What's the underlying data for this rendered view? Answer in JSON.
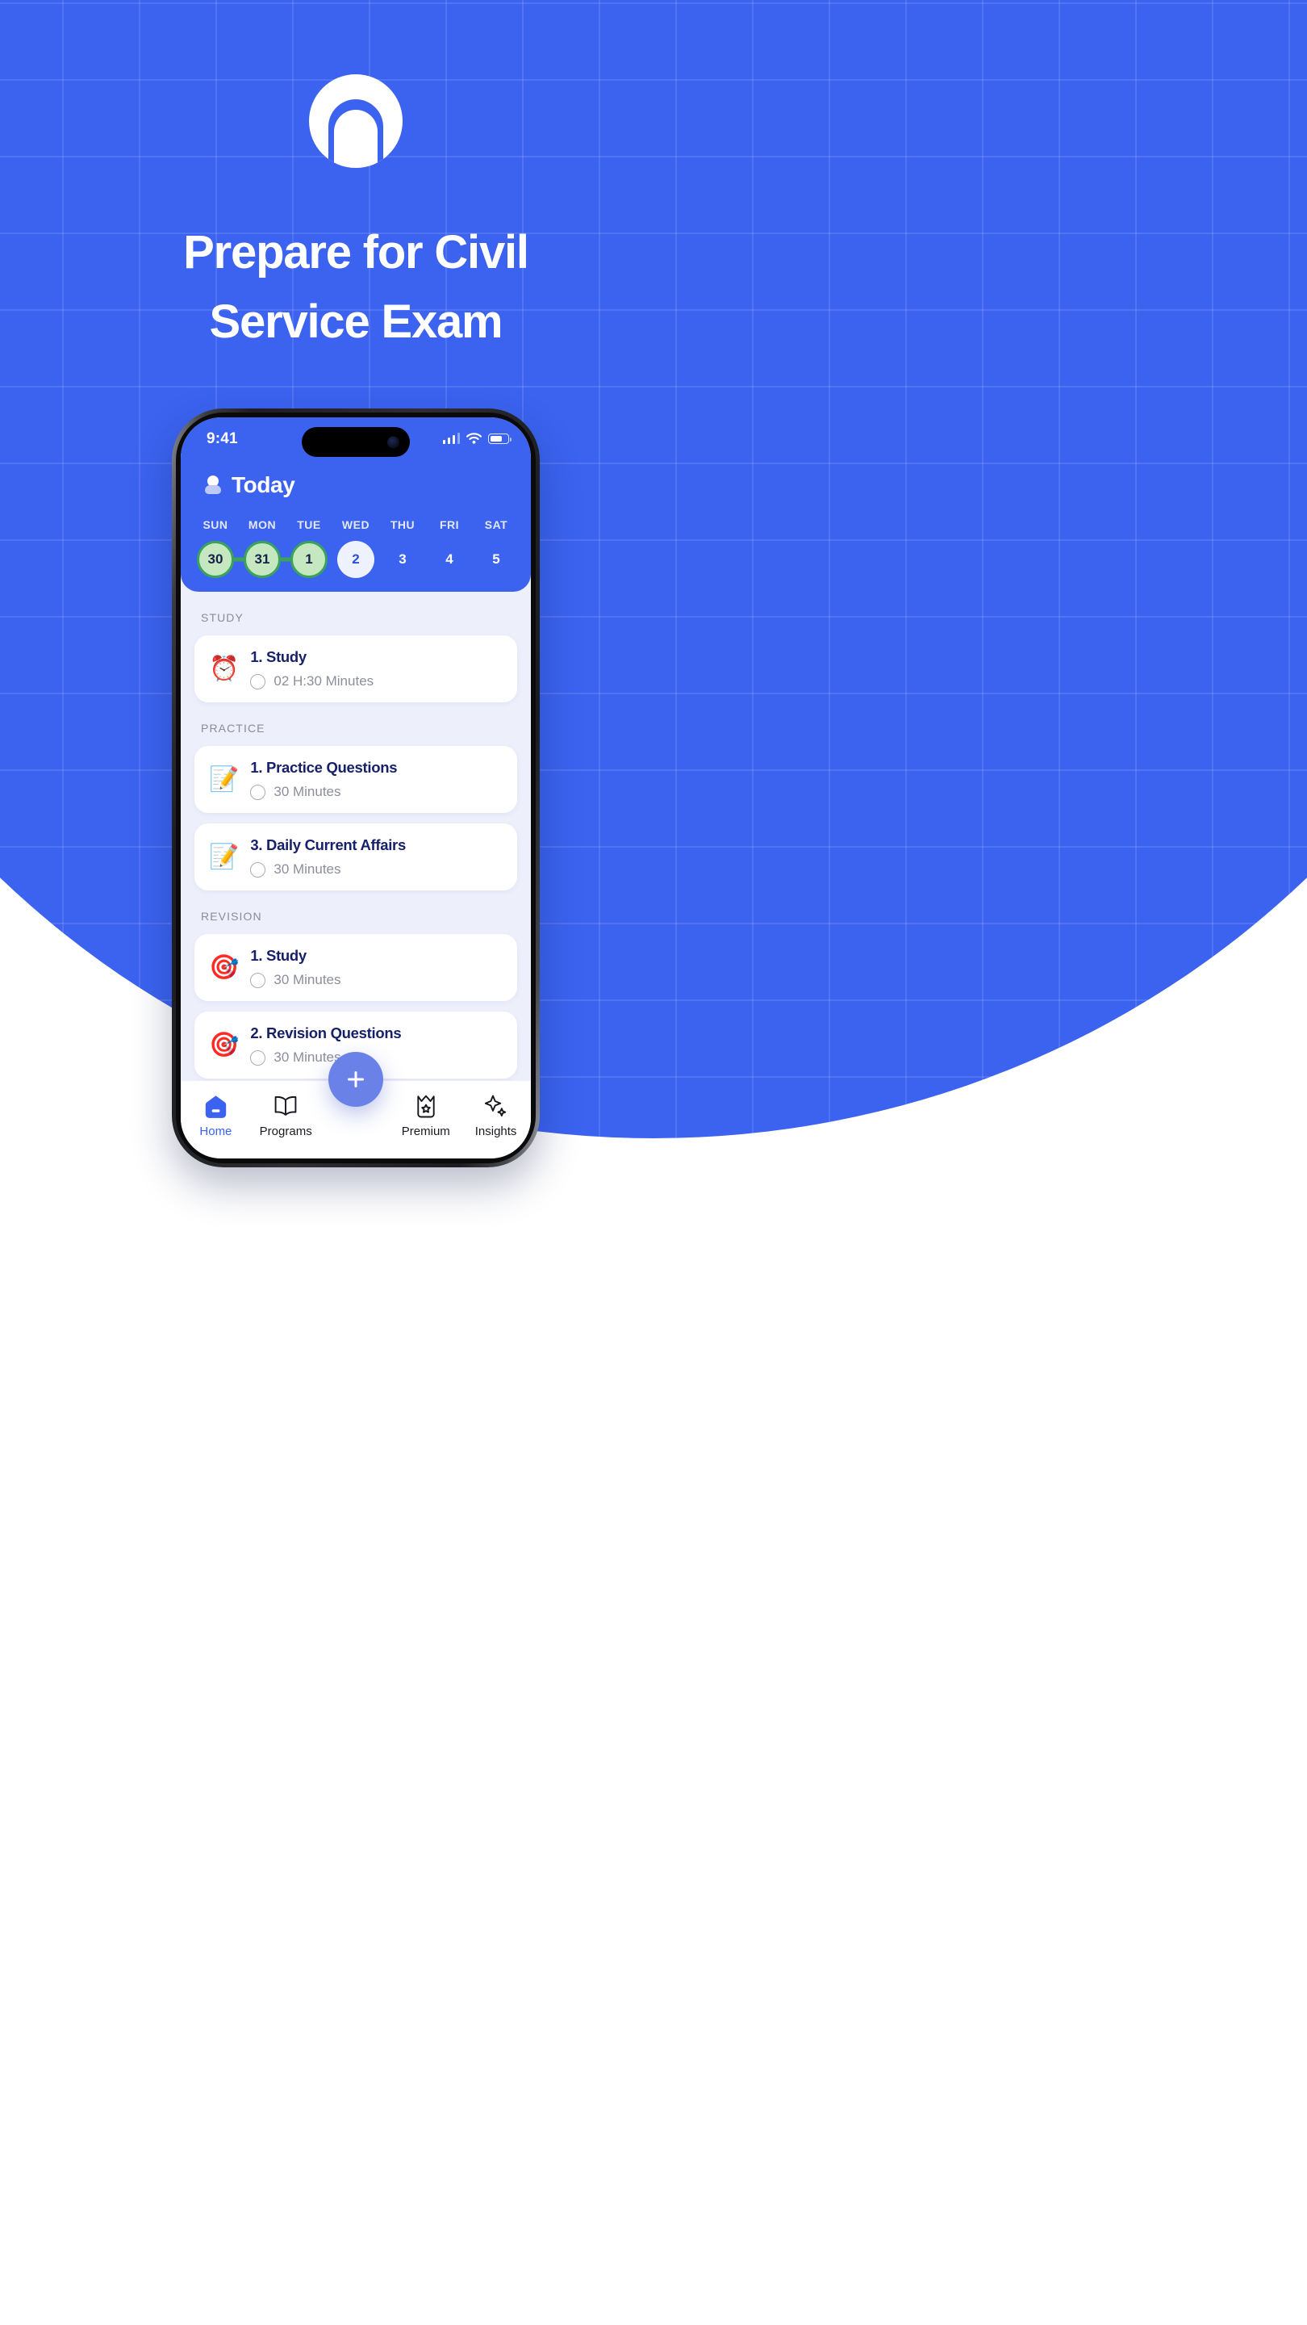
{
  "promo": {
    "logo_icon": "arch-circle-logo",
    "headline_line1": "Prepare for Civil",
    "headline_line2": "Service Exam",
    "bg_color": "#3B63F0",
    "accent_color": "#6A81E8"
  },
  "phone": {
    "status_bar": {
      "time": "9:41",
      "signal_icon": "cellular-signal-icon",
      "wifi_icon": "wifi-icon",
      "battery_icon": "battery-icon",
      "battery_level": "70%"
    },
    "header": {
      "avatar_icon": "person-avatar-icon",
      "title": "Today"
    },
    "calendar": {
      "weekdays": [
        "SUN",
        "MON",
        "TUE",
        "WED",
        "THU",
        "FRI",
        "SAT"
      ],
      "days": [
        {
          "num": "30",
          "state": "done"
        },
        {
          "num": "31",
          "state": "done"
        },
        {
          "num": "1",
          "state": "done"
        },
        {
          "num": "2",
          "state": "today"
        },
        {
          "num": "3",
          "state": "plain"
        },
        {
          "num": "4",
          "state": "plain"
        },
        {
          "num": "5",
          "state": "plain"
        }
      ],
      "done_color": "#C5E8C0",
      "done_border_color": "#3AA359",
      "today_color": "#EEF1FE"
    },
    "sections": [
      {
        "label": "STUDY",
        "tasks": [
          {
            "emoji": "⏰",
            "icon_name": "alarm-clock-icon",
            "title": "1. Study",
            "duration": "02 H:30 Minutes"
          }
        ]
      },
      {
        "label": "PRACTICE",
        "tasks": [
          {
            "emoji": "📝",
            "icon_name": "memo-pencil-icon",
            "title": "1. Practice Questions",
            "duration": "30 Minutes"
          },
          {
            "emoji": "📝",
            "icon_name": "memo-pencil-icon",
            "title": "3. Daily Current Affairs",
            "duration": "30 Minutes"
          }
        ]
      },
      {
        "label": "REVISION",
        "tasks": [
          {
            "emoji": "🎯",
            "icon_name": "dart-target-icon",
            "title": "1. Study",
            "duration": "30 Minutes"
          },
          {
            "emoji": "🎯",
            "icon_name": "dart-target-icon",
            "title": "2. Revision Questions",
            "duration": "30 Minutes"
          }
        ]
      }
    ],
    "fab": {
      "icon": "plus-icon",
      "label": "+"
    },
    "bottom_nav": {
      "items": [
        {
          "label": "Home",
          "icon_name": "home-icon",
          "active": true
        },
        {
          "label": "Programs",
          "icon_name": "book-icon",
          "active": false
        },
        {
          "label": "Premium",
          "icon_name": "crown-icon",
          "active": false
        },
        {
          "label": "Insights",
          "icon_name": "sparkles-icon",
          "active": false
        }
      ]
    }
  }
}
